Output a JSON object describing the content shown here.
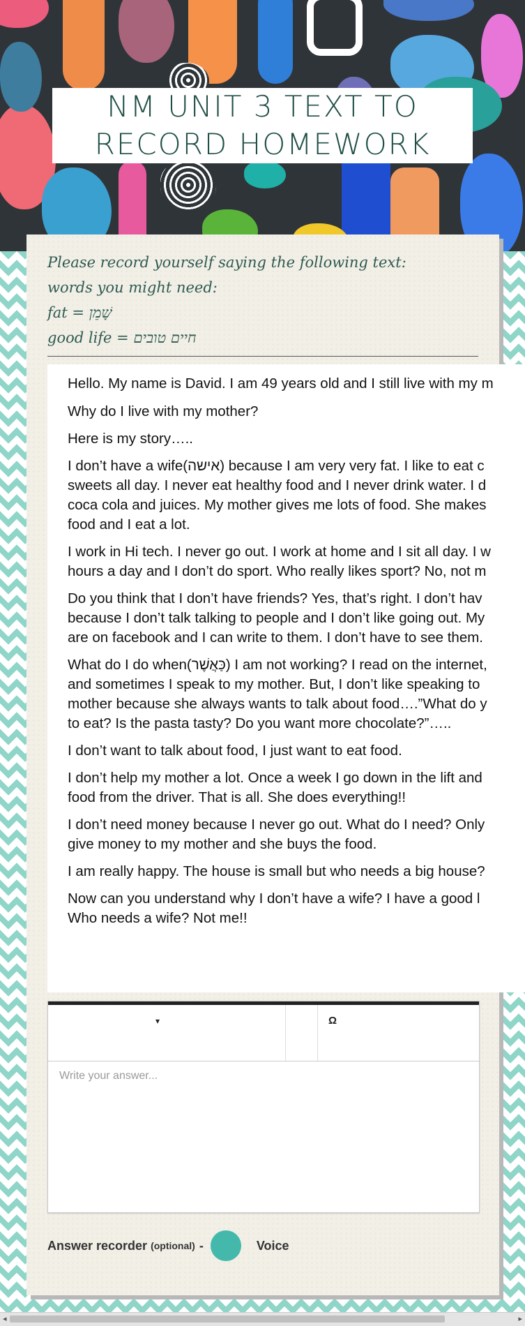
{
  "page_title": "NM UNIT 3 TEXT TO RECORD HOMEWORK",
  "instructions": [
    "Please record yourself saying the following text:",
    "words you might need:",
    "fat =  שָׁמֵן",
    "good life  = חיים טובים"
  ],
  "document_lines": [
    "Hello. My name is David. I am 49 years old and I still live with my m",
    "Why do I live with my mother?",
    "Here is my story…..",
    "I don’t have a wife(אישה) because I am very very fat. I like to eat c",
    "sweets all day. I never eat healthy food and I never drink water. I d",
    "coca cola and juices. My mother gives me lots of food. She makes",
    "food and I eat a lot.",
    "I work in Hi tech. I never go out. I work at home and I sit all day. I w",
    "hours a day and I don’t do sport. Who really likes sport? No, not m",
    "Do you think that I don’t have friends? Yes, that’s right. I don’t hav",
    "because I don’t talk talking to people and I don’t like going out. My",
    "are on facebook and I can write to them. I don’t have to see them.",
    "What do I do when(כַּאֲשֶׁר) I am not working? I read on the internet,",
    "and sometimes I speak to my mother. But, I don’t like speaking to",
    "mother because she always wants to talk about food….”What do y",
    "to eat? Is the pasta tasty? Do you want more chocolate?”…..",
    "I don’t want to talk about food, I just want to eat food.",
    "I don’t help my mother a lot. Once a week I go down in the lift and",
    "food from the driver. That is all. She does everything!!",
    "I don’t need money because I never go out. What do I need? Only",
    "give money to my mother and she buys the food.",
    "I am really happy. The house is small but who needs a big house?",
    "Now can you understand why I don’t have a wife? I have a  good l",
    "Who needs a wife? Not me!!"
  ],
  "editor": {
    "special_char_label": "Ω",
    "answer_placeholder": "Write your answer..."
  },
  "recorder": {
    "label": "Answer recorder",
    "optional": "(optional)",
    "dash": "-",
    "voice_label": "Voice",
    "accent_color": "#45b8ac"
  },
  "colors": {
    "title_text": "#1f4f45",
    "chevron": "#8fd5c8",
    "header_bg": "#2f3438"
  }
}
